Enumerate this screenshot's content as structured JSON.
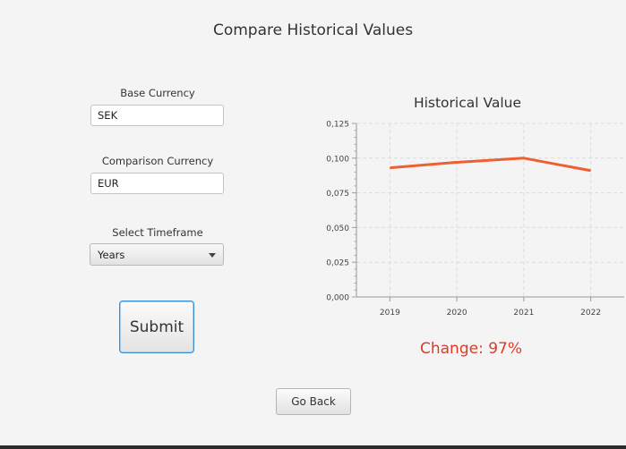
{
  "page": {
    "title": "Compare Historical Values"
  },
  "form": {
    "base_currency": {
      "label": "Base Currency",
      "value": "SEK"
    },
    "comparison_currency": {
      "label": "Comparison Currency",
      "value": "EUR"
    },
    "timeframe": {
      "label": "Select Timeframe",
      "value": "Years"
    },
    "submit_label": "Submit"
  },
  "chart": {
    "title": "Historical Value",
    "change_text": "Change: 97%"
  },
  "chart_data": {
    "type": "line",
    "title": "Historical Value",
    "x": [
      "2019",
      "2020",
      "2021",
      "2022"
    ],
    "series": [
      {
        "values": [
          0.093,
          0.097,
          0.1,
          0.091
        ]
      }
    ],
    "yticks": [
      "0,000",
      "0,025",
      "0,050",
      "0,075",
      "0,100",
      "0,125"
    ],
    "ylim": [
      0,
      0.125
    ],
    "grid": true,
    "line_color": "#ec6033"
  },
  "footer": {
    "back_label": "Go Back"
  }
}
